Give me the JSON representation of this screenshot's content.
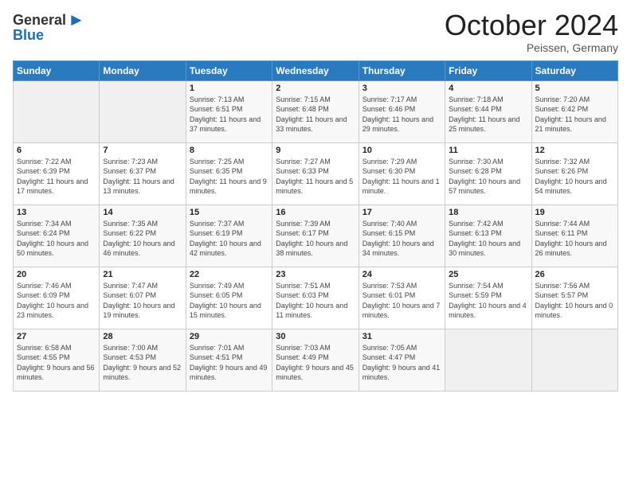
{
  "logo": {
    "general": "General",
    "blue": "Blue"
  },
  "header": {
    "month_year": "October 2024",
    "location": "Peissen, Germany"
  },
  "weekdays": [
    "Sunday",
    "Monday",
    "Tuesday",
    "Wednesday",
    "Thursday",
    "Friday",
    "Saturday"
  ],
  "weeks": [
    [
      {
        "day": "",
        "info": ""
      },
      {
        "day": "",
        "info": ""
      },
      {
        "day": "1",
        "info": "Sunrise: 7:13 AM\nSunset: 6:51 PM\nDaylight: 11 hours and 37 minutes."
      },
      {
        "day": "2",
        "info": "Sunrise: 7:15 AM\nSunset: 6:48 PM\nDaylight: 11 hours and 33 minutes."
      },
      {
        "day": "3",
        "info": "Sunrise: 7:17 AM\nSunset: 6:46 PM\nDaylight: 11 hours and 29 minutes."
      },
      {
        "day": "4",
        "info": "Sunrise: 7:18 AM\nSunset: 6:44 PM\nDaylight: 11 hours and 25 minutes."
      },
      {
        "day": "5",
        "info": "Sunrise: 7:20 AM\nSunset: 6:42 PM\nDaylight: 11 hours and 21 minutes."
      }
    ],
    [
      {
        "day": "6",
        "info": "Sunrise: 7:22 AM\nSunset: 6:39 PM\nDaylight: 11 hours and 17 minutes."
      },
      {
        "day": "7",
        "info": "Sunrise: 7:23 AM\nSunset: 6:37 PM\nDaylight: 11 hours and 13 minutes."
      },
      {
        "day": "8",
        "info": "Sunrise: 7:25 AM\nSunset: 6:35 PM\nDaylight: 11 hours and 9 minutes."
      },
      {
        "day": "9",
        "info": "Sunrise: 7:27 AM\nSunset: 6:33 PM\nDaylight: 11 hours and 5 minutes."
      },
      {
        "day": "10",
        "info": "Sunrise: 7:29 AM\nSunset: 6:30 PM\nDaylight: 11 hours and 1 minute."
      },
      {
        "day": "11",
        "info": "Sunrise: 7:30 AM\nSunset: 6:28 PM\nDaylight: 10 hours and 57 minutes."
      },
      {
        "day": "12",
        "info": "Sunrise: 7:32 AM\nSunset: 6:26 PM\nDaylight: 10 hours and 54 minutes."
      }
    ],
    [
      {
        "day": "13",
        "info": "Sunrise: 7:34 AM\nSunset: 6:24 PM\nDaylight: 10 hours and 50 minutes."
      },
      {
        "day": "14",
        "info": "Sunrise: 7:35 AM\nSunset: 6:22 PM\nDaylight: 10 hours and 46 minutes."
      },
      {
        "day": "15",
        "info": "Sunrise: 7:37 AM\nSunset: 6:19 PM\nDaylight: 10 hours and 42 minutes."
      },
      {
        "day": "16",
        "info": "Sunrise: 7:39 AM\nSunset: 6:17 PM\nDaylight: 10 hours and 38 minutes."
      },
      {
        "day": "17",
        "info": "Sunrise: 7:40 AM\nSunset: 6:15 PM\nDaylight: 10 hours and 34 minutes."
      },
      {
        "day": "18",
        "info": "Sunrise: 7:42 AM\nSunset: 6:13 PM\nDaylight: 10 hours and 30 minutes."
      },
      {
        "day": "19",
        "info": "Sunrise: 7:44 AM\nSunset: 6:11 PM\nDaylight: 10 hours and 26 minutes."
      }
    ],
    [
      {
        "day": "20",
        "info": "Sunrise: 7:46 AM\nSunset: 6:09 PM\nDaylight: 10 hours and 23 minutes."
      },
      {
        "day": "21",
        "info": "Sunrise: 7:47 AM\nSunset: 6:07 PM\nDaylight: 10 hours and 19 minutes."
      },
      {
        "day": "22",
        "info": "Sunrise: 7:49 AM\nSunset: 6:05 PM\nDaylight: 10 hours and 15 minutes."
      },
      {
        "day": "23",
        "info": "Sunrise: 7:51 AM\nSunset: 6:03 PM\nDaylight: 10 hours and 11 minutes."
      },
      {
        "day": "24",
        "info": "Sunrise: 7:53 AM\nSunset: 6:01 PM\nDaylight: 10 hours and 7 minutes."
      },
      {
        "day": "25",
        "info": "Sunrise: 7:54 AM\nSunset: 5:59 PM\nDaylight: 10 hours and 4 minutes."
      },
      {
        "day": "26",
        "info": "Sunrise: 7:56 AM\nSunset: 5:57 PM\nDaylight: 10 hours and 0 minutes."
      }
    ],
    [
      {
        "day": "27",
        "info": "Sunrise: 6:58 AM\nSunset: 4:55 PM\nDaylight: 9 hours and 56 minutes."
      },
      {
        "day": "28",
        "info": "Sunrise: 7:00 AM\nSunset: 4:53 PM\nDaylight: 9 hours and 52 minutes."
      },
      {
        "day": "29",
        "info": "Sunrise: 7:01 AM\nSunset: 4:51 PM\nDaylight: 9 hours and 49 minutes."
      },
      {
        "day": "30",
        "info": "Sunrise: 7:03 AM\nSunset: 4:49 PM\nDaylight: 9 hours and 45 minutes."
      },
      {
        "day": "31",
        "info": "Sunrise: 7:05 AM\nSunset: 4:47 PM\nDaylight: 9 hours and 41 minutes."
      },
      {
        "day": "",
        "info": ""
      },
      {
        "day": "",
        "info": ""
      }
    ]
  ]
}
